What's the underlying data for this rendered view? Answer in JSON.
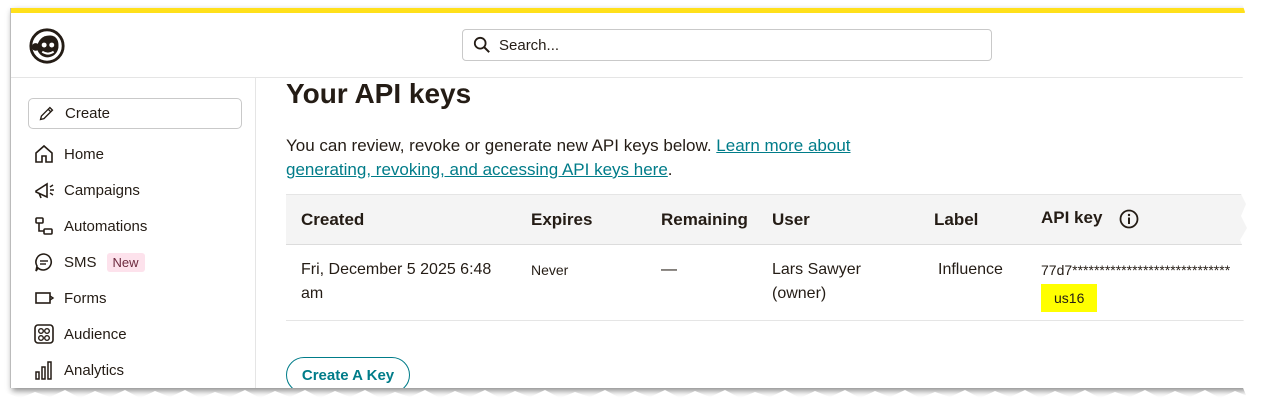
{
  "search": {
    "placeholder": "Search..."
  },
  "sidebar": {
    "create_label": "Create",
    "items": [
      {
        "label": "Home",
        "icon": "home-icon"
      },
      {
        "label": "Campaigns",
        "icon": "megaphone-icon"
      },
      {
        "label": "Automations",
        "icon": "automations-icon"
      },
      {
        "label": "SMS",
        "icon": "sms-icon",
        "badge": "New"
      },
      {
        "label": "Forms",
        "icon": "forms-icon"
      },
      {
        "label": "Audience",
        "icon": "audience-icon"
      },
      {
        "label": "Analytics",
        "icon": "analytics-icon"
      }
    ]
  },
  "main": {
    "title": "Your API keys",
    "description_prefix": "You can review, revoke or generate new API keys below. ",
    "description_link": "Learn more about generating, revoking, and accessing API keys here",
    "description_suffix": ".",
    "table": {
      "headers": [
        "Created",
        "Expires",
        "Remaining",
        "User",
        "Label",
        "API key"
      ],
      "rows": [
        {
          "created": "Fri, December 5 2025 6:48 am",
          "expires": "Never",
          "remaining": "—",
          "user": "Lars Sawyer (owner)",
          "label": "Influence",
          "api_key": "77d7*****************************",
          "server": "us16"
        }
      ]
    },
    "create_key_label": "Create A Key"
  },
  "colors": {
    "accent_yellow": "#ffe01b",
    "link_teal": "#007c89",
    "highlight": "#ffff00"
  }
}
